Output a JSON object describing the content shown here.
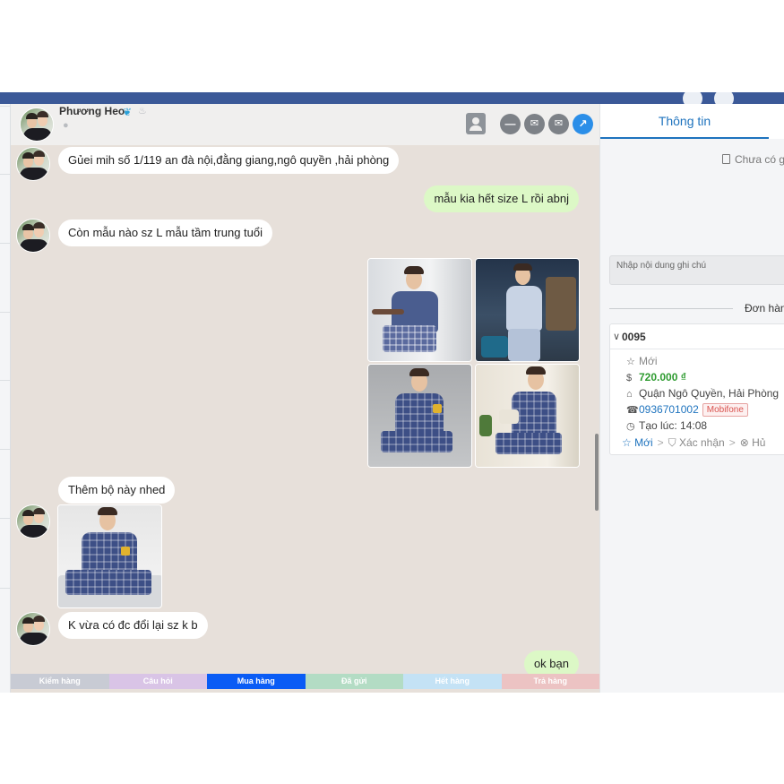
{
  "chat": {
    "contact_name": "Phương Heo",
    "messages": [
      {
        "side": "in",
        "text": "Gủei mih số 1/119 an đà nội,đằng giang,ngô quyền ,hải phòng"
      },
      {
        "side": "out",
        "text": "mẫu kia hết size L rồi abnj"
      },
      {
        "side": "in",
        "text": "Còn mẫu nào sz L mẫu tầm trung tuổi"
      },
      {
        "side": "in",
        "text": "Thêm bộ này nhed"
      },
      {
        "side": "in",
        "text": "K vừa có đc đổi lại sz k b"
      },
      {
        "side": "out",
        "text": "ok bạn"
      }
    ]
  },
  "tags": [
    {
      "label": "Kiểm hàng",
      "color": "#c8cbd4"
    },
    {
      "label": "Câu hỏi",
      "color": "#d9c4e6"
    },
    {
      "label": "Mua hàng",
      "color": "#0a5cf5"
    },
    {
      "label": "Đã gửi",
      "color": "#b3dcc4"
    },
    {
      "label": "Hết hàng",
      "color": "#c4e2f5"
    },
    {
      "label": "Trả hàng",
      "color": "#ecc3c3"
    }
  ],
  "info_panel": {
    "tab_label": "Thông tin",
    "no_note_text": "Chưa có g",
    "note_placeholder": "Nhập nội dung ghi chú",
    "orders_title": "Đơn hàn",
    "order": {
      "code": "0095",
      "status": "Mới",
      "price": "720.000 ₫",
      "address": "Quận Ngô Quyền, Hải Phòng",
      "phone": "0936701002",
      "carrier": "Mobifone",
      "created": "Tạo lúc: 14:08",
      "steps": [
        "Mới",
        "Xác nhận",
        "Hủ"
      ]
    }
  }
}
